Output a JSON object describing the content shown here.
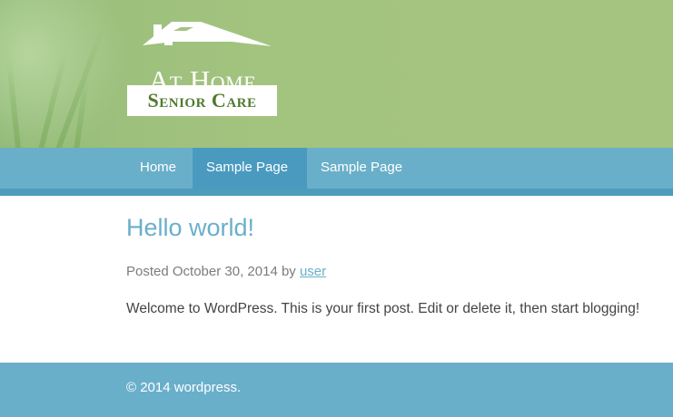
{
  "header": {
    "logo": {
      "title": "At Home",
      "subtitle": "Senior Care"
    }
  },
  "nav": {
    "items": [
      {
        "label": "Home",
        "active": false
      },
      {
        "label": "Sample Page",
        "active": true
      },
      {
        "label": "Sample Page",
        "active": false
      }
    ]
  },
  "post": {
    "title": "Hello world!",
    "meta_prefix": "Posted October 30, 2014 by ",
    "author": "user",
    "body": "Welcome to WordPress. This is your first post. Edit or delete it, then start blogging!"
  },
  "footer": {
    "text": "© 2014 wordpress."
  },
  "colors": {
    "header_green": "#a4c47f",
    "nav_blue": "#6aafca",
    "nav_active": "#4a9ac0",
    "title_blue": "#6aafca",
    "logo_green": "#4f7a2e"
  }
}
